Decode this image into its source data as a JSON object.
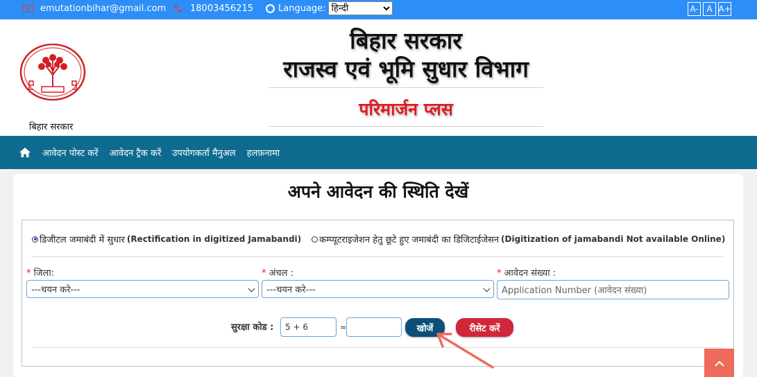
{
  "topbar": {
    "email": "emutationbihar@gmail.com",
    "phone": "18003456215",
    "language_label": "Language:",
    "language_selected": "हिन्दी",
    "font_small": "A-",
    "font_normal": "A",
    "font_large": "A+"
  },
  "header": {
    "emblem_caption": "बिहार सरकार",
    "title_line1": "बिहार सरकार",
    "title_line2": "राजस्व एवं भूमि सुधार विभाग",
    "subtitle": "परिमार्जन प्लस"
  },
  "nav": {
    "items": [
      "आवेदन पोस्ट करें",
      "आवेदन ट्रैक करें",
      "उपयोगकर्ता मैनुअल",
      "हलफ़नामा"
    ]
  },
  "panel": {
    "title": "अपने आवेदन की स्थिति देखें",
    "radio1_hi": "डिजीटल जमाबंदी में सुधार",
    "radio1_en": "(Rectification in digitized Jamabandi)",
    "radio2_hi": "कम्प्यूटराइजेशन हेतु छूटे हुए जमाबंदी का डिजिटाईजेसन",
    "radio2_en": "(Digitization of jamabandi Not available Online)",
    "district_label": "जिला:",
    "circle_label": "अंचल :",
    "application_label": "आवेदन संख्या :",
    "select_placeholder": "---चयन करे---",
    "application_placeholder": "Application Number (आवेदन संख्या)",
    "captcha_label": "सुरक्षा कोड :",
    "captcha_value": "5 + 6",
    "equals": "=",
    "search_button": "खोजें",
    "reset_button": "रीसेट करें"
  },
  "colors": {
    "topbar": "#2d8ef7",
    "nav": "#0e6b8f",
    "subtitle": "#e0191f",
    "search_button": "#0d4f7a",
    "reset_button": "#d0273a",
    "arrow": "#f06a5c"
  }
}
